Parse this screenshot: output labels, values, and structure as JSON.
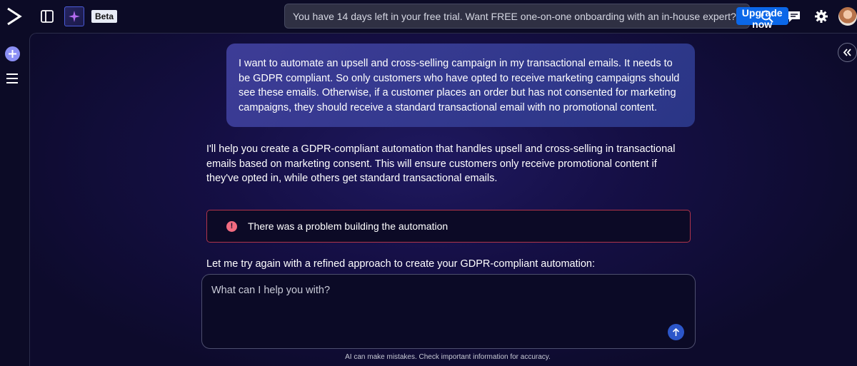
{
  "header": {
    "beta_label": "Beta",
    "trial_banner": {
      "text": "You have 14 days left in your free trial. Want FREE one-on-one onboarding with an in-house expert?",
      "button_label": "Upgrade now"
    },
    "icons": [
      "app-logo-icon",
      "panel-toggle-icon",
      "sparkle-icon",
      "search-icon",
      "feedback-icon",
      "gear-icon"
    ]
  },
  "sidebar": {
    "icons": [
      "plus-icon",
      "menu-icon"
    ]
  },
  "chat": {
    "user_message": "I want to automate an upsell and cross-selling campaign in my transactional emails. It needs to be GDPR compliant. So only customers who have opted to receive marketing campaigns should see these emails. Otherwise, if a customer places an order but has not consented for marketing campaigns, they should receive a standard transactional email with no promotional content.",
    "assistant_message": "I'll help you create a GDPR-compliant automation that handles upsell and cross-selling in transactional emails based on marketing consent. This will ensure customers only receive promotional content if they've opted in, while others get standard transactional emails.",
    "error_message": "There was a problem building the automation",
    "retry_message": "Let me try again with a refined approach to create your GDPR-compliant automation:"
  },
  "composer": {
    "placeholder": "What can I help you with?",
    "value": ""
  },
  "footer": {
    "disclaimer": "AI can make mistakes. Check important information for accuracy."
  },
  "colors": {
    "accent": "#0b67e8",
    "background": "#0b0a24",
    "user_bubble": "#3d3c96",
    "error_border": "#b0344a",
    "error_icon": "#f26b80"
  }
}
